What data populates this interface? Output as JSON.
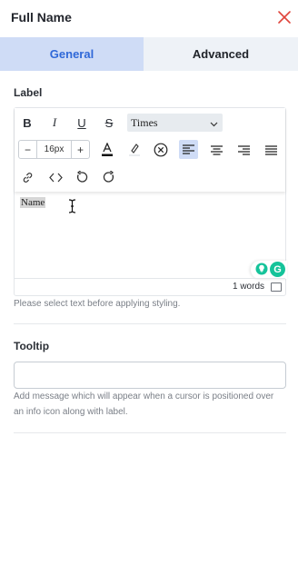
{
  "panel": {
    "title": "Full Name",
    "close_icon": "close-icon",
    "accent_color": "#e0443b"
  },
  "tabs": [
    {
      "label": "General",
      "active": true,
      "color": "#2f68d8"
    },
    {
      "label": "Advanced",
      "active": false
    }
  ],
  "label_section": {
    "heading": "Label",
    "toolbar": {
      "row1": [
        "bold-icon",
        "italic-icon",
        "underline-icon",
        "strikethrough-icon"
      ],
      "font_family": "Times",
      "font_size": "16px",
      "size_decrement": "−",
      "size_increment": "+",
      "row2_icons": [
        "font-color-icon",
        "highlight-icon",
        "clear-format-icon",
        "align-left-icon",
        "align-center-icon",
        "align-right-icon",
        "align-justify-icon"
      ],
      "row3_icons": [
        "link-icon",
        "code-icon",
        "undo-icon",
        "redo-icon"
      ]
    },
    "content_text": "Name",
    "grammarly_icon": "G",
    "word_count": "1 words",
    "hint": "Please select text before applying styling."
  },
  "tooltip_section": {
    "heading": "Tooltip",
    "input_value": "",
    "input_placeholder": "",
    "hint": "Add message which will appear when a cursor is positioned over an info icon along with label."
  }
}
